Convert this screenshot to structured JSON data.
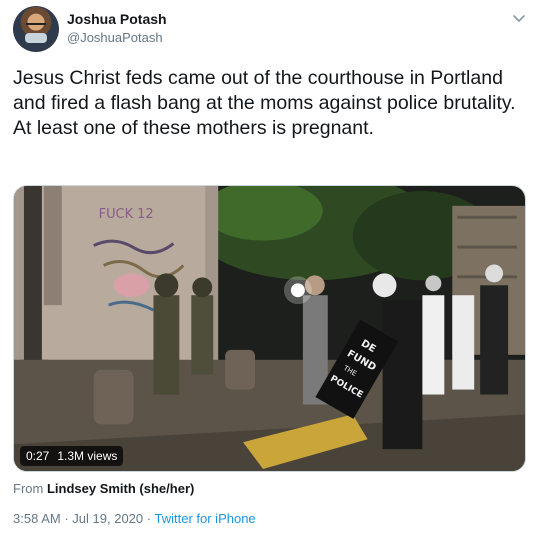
{
  "author": {
    "name": "Joshua Potash",
    "handle": "@JoshuaPotash"
  },
  "tweet": {
    "text": "Jesus Christ feds came out of the courthouse in Portland and fired a flash bang at the moms against police brutality. At least one of these mothers is pregnant."
  },
  "video": {
    "duration": "0:27",
    "views": "1.3M views",
    "graffiti": "FUCK 12",
    "sign_line1": "DE",
    "sign_line2": "FUND",
    "sign_line3": "THE",
    "sign_line4": "POLICE"
  },
  "attribution": {
    "prefix": "From",
    "name": "Lindsey Smith (she/her)"
  },
  "meta": {
    "time": "3:58 AM",
    "separator1": "·",
    "date": "Jul 19, 2020",
    "separator2": "·",
    "source": "Twitter for iPhone"
  },
  "colors": {
    "link": "#1b95e0",
    "secondary_text": "#657786",
    "primary_text": "#14171a"
  },
  "icons": {
    "menu": "chevron-down-icon"
  }
}
